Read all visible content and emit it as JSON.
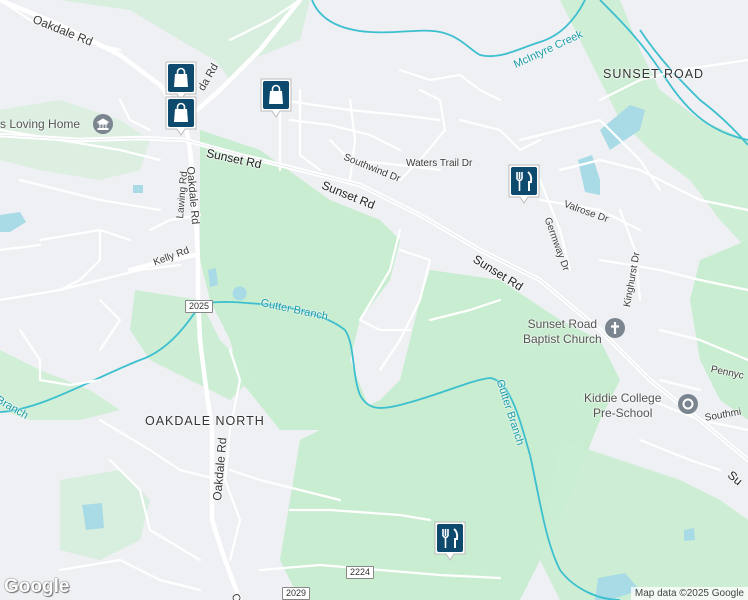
{
  "areas": {
    "sunset_road": "SUNSET ROAD",
    "oakdale_north": "OAKDALE NORTH"
  },
  "roads": {
    "oakdale_rd_top": "Oakdale Rd",
    "oakdale_rd_vertical": "Oakdale Rd",
    "oakdale_rd_bottom": "O",
    "sunset_rd_1": "Sunset Rd",
    "sunset_rd_2": "Sunset Rd",
    "sunset_rd_3": "Sunset Rd",
    "sunset_rd_partial": "Su",
    "lawing_rd": "Lawing Rd",
    "kelly_rd": "Kelly Rd",
    "southwind_dr": "Southwind Dr",
    "waters_trail_dr": "Waters Trail Dr",
    "valrose_dr": "Valrose Dr",
    "germway_dr": "Germway Dr",
    "kinghurst_dr": "Kinghurst Dr",
    "pennyc": "Pennyc",
    "southmi": "Southmi",
    "da_rd_partial": "da Rd"
  },
  "water": {
    "mcintyre_creek": "McIntyre Creek",
    "gutter_branch_1": "Gutter Branch",
    "gutter_branch_2": "Gutter Branch",
    "gutter_branch_3": "Branch"
  },
  "pois": {
    "loving_home": "s Loving Home",
    "church_line1": "Sunset Road",
    "church_line2": "Baptist Church",
    "school_line1": "Kiddie College",
    "school_line2": "Pre-School"
  },
  "shields": {
    "s2025": "2025",
    "s2224": "2224",
    "s2029": "2029"
  },
  "markers": [
    {
      "type": "shopping",
      "icon": "shopping-bag-icon"
    },
    {
      "type": "shopping",
      "icon": "shopping-bag-icon"
    },
    {
      "type": "shopping",
      "icon": "shopping-bag-icon"
    },
    {
      "type": "restaurant",
      "icon": "fork-knife-icon"
    },
    {
      "type": "restaurant",
      "icon": "fork-knife-icon"
    }
  ],
  "attribution": {
    "logo": "Google",
    "copyright": "Map data ©2025 Google"
  },
  "colors": {
    "park": "#c9edd0",
    "water": "#a8dbe6",
    "water_line": "#3cbfcf",
    "marker": "#0d4a6e",
    "background": "#eef0f3"
  }
}
